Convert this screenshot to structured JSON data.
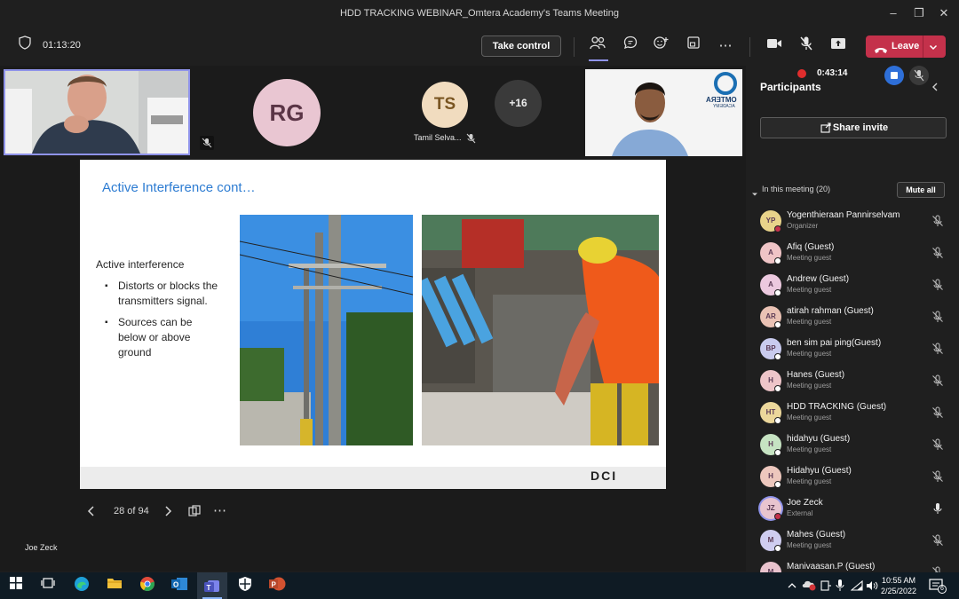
{
  "window": {
    "title": "HDD TRACKING WEBINAR_Omtera Academy's Teams Meeting"
  },
  "toolbar": {
    "timer": "01:13:20",
    "take_control": "Take control",
    "leave": "Leave"
  },
  "recording": {
    "time": "0:43:14"
  },
  "tiles": {
    "rg_initials": "RG",
    "ts_initials": "TS",
    "ts_name": "Tamil Selva...",
    "overflow": "+16",
    "presenter_label": "Joe Zeck",
    "logo_text_1": "OMTERA",
    "logo_text_2": "ACADEMY"
  },
  "slide": {
    "title": "Active Interference cont…",
    "heading": "Active interference",
    "bullets": [
      "Distorts or blocks the transmitters signal.",
      "Sources can be below or above ground"
    ],
    "logo": "DCI"
  },
  "pager": {
    "page": "28 of 94"
  },
  "panel": {
    "title": "Participants",
    "share_invite": "Share invite",
    "section": "In this meeting (20)",
    "mute_all": "Mute all",
    "participants": [
      {
        "initials": "YP",
        "name": "Yogenthieraan Pannirselvam",
        "role": "Organizer",
        "color": "#e8d38a",
        "status": "#c4314b",
        "mic": "muted"
      },
      {
        "initials": "A",
        "name": "Afiq (Guest)",
        "role": "Meeting guest",
        "color": "#efc4c6",
        "status": "#ffffff",
        "mic": "muted"
      },
      {
        "initials": "A",
        "name": "Andrew (Guest)",
        "role": "Meeting guest",
        "color": "#ecc9df",
        "status": "#ffffff",
        "mic": "muted"
      },
      {
        "initials": "AR",
        "name": "atirah rahman (Guest)",
        "role": "Meeting guest",
        "color": "#eac2b4",
        "status": "#ffffff",
        "mic": "muted"
      },
      {
        "initials": "BP",
        "name": "ben sim pai ping(Guest)",
        "role": "Meeting guest",
        "color": "#c9cbee",
        "status": "#ffffff",
        "mic": "muted"
      },
      {
        "initials": "H",
        "name": "Hanes (Guest)",
        "role": "Meeting guest",
        "color": "#eec5c9",
        "status": "#ffffff",
        "mic": "muted"
      },
      {
        "initials": "HT",
        "name": "HDD TRACKING (Guest)",
        "role": "Meeting guest",
        "color": "#ecd79b",
        "status": "#ffffff",
        "mic": "muted"
      },
      {
        "initials": "H",
        "name": "hidahyu (Guest)",
        "role": "Meeting guest",
        "color": "#c6e3c2",
        "status": "#ffffff",
        "mic": "muted"
      },
      {
        "initials": "H",
        "name": "Hidahyu (Guest)",
        "role": "Meeting guest",
        "color": "#edc7bd",
        "status": "#ffffff",
        "mic": "muted"
      },
      {
        "initials": "JZ",
        "name": "Joe Zeck",
        "role": "External",
        "color": "#e8c4cf",
        "status": "#c4314b",
        "mic": "on"
      },
      {
        "initials": "M",
        "name": "Mahes (Guest)",
        "role": "Meeting guest",
        "color": "#cfcdf0",
        "status": "#ffffff",
        "mic": "muted"
      },
      {
        "initials": "M",
        "name": "Manivaasan.P (Guest)",
        "role": "Meeting guest",
        "color": "#e9c3cd",
        "status": "#ffffff",
        "mic": "muted"
      }
    ]
  },
  "taskbar": {
    "time": "10:55 AM",
    "date": "2/25/2022",
    "notifications": "6"
  }
}
